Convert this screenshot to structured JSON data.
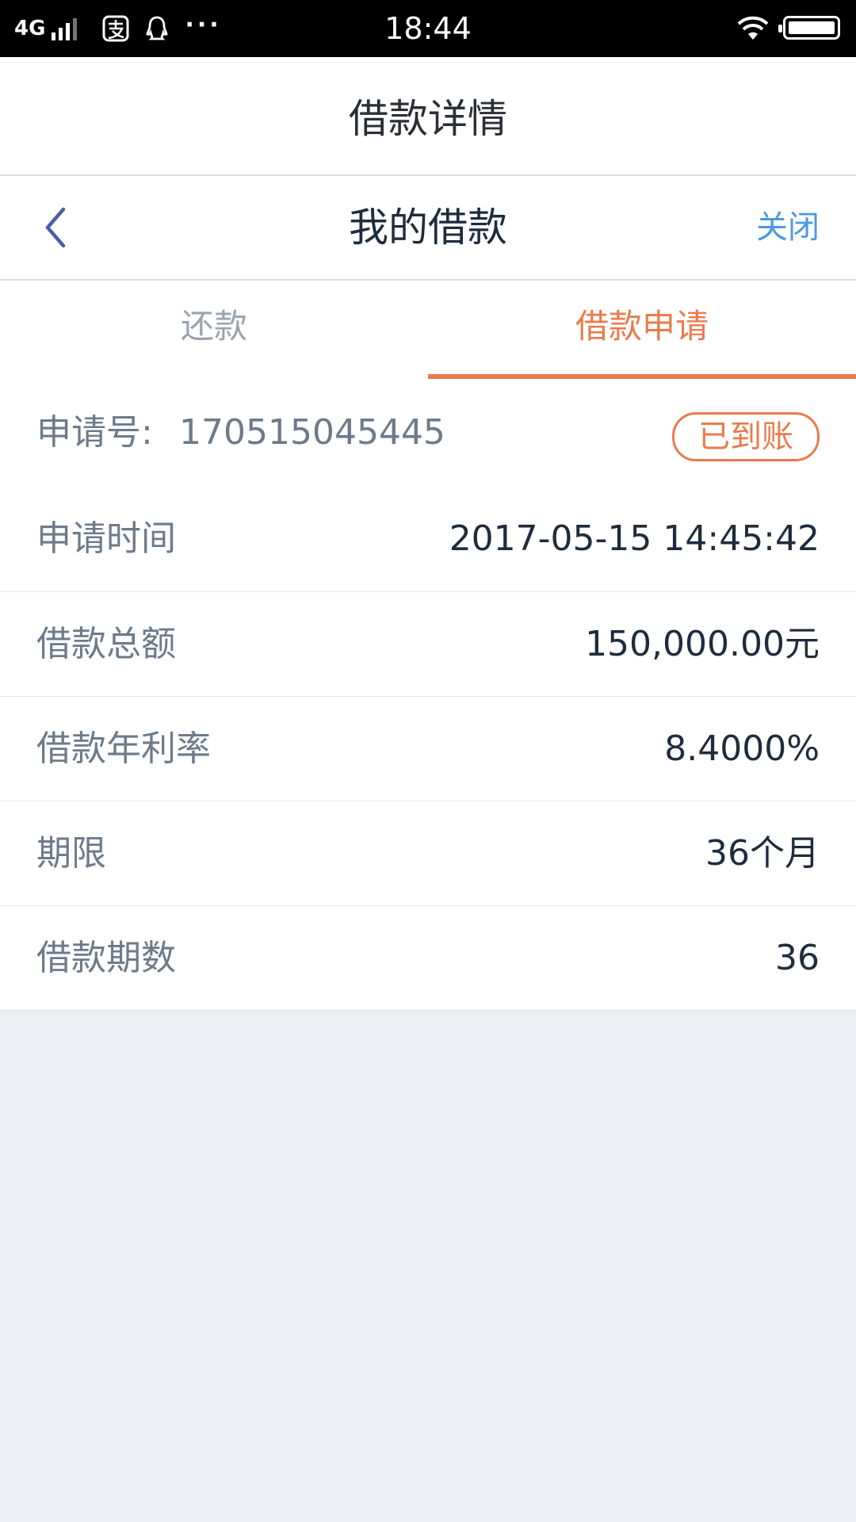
{
  "status_bar": {
    "network": "4G",
    "time": "18:44",
    "more": "···"
  },
  "app_title": "借款详情",
  "nav": {
    "title": "我的借款",
    "close_label": "关闭"
  },
  "tabs": [
    {
      "label": "还款",
      "active": false
    },
    {
      "label": "借款申请",
      "active": true
    }
  ],
  "application": {
    "number_label": "申请号:",
    "number_value": "170515045445",
    "status_badge": "已到账"
  },
  "details": [
    {
      "label": "申请时间",
      "value": "2017-05-15 14:45:42"
    },
    {
      "label": "借款总额",
      "value": "150,000.00元"
    },
    {
      "label": "借款年利率",
      "value": "8.4000%"
    },
    {
      "label": "期限",
      "value": "36个月"
    },
    {
      "label": "借款期数",
      "value": "36"
    }
  ],
  "colors": {
    "accent_orange": "#ea7a4d",
    "link_blue": "#4b9ae0",
    "back_arrow": "#4a5fa8",
    "page_background": "#ebeff3"
  }
}
